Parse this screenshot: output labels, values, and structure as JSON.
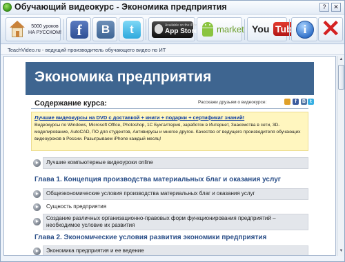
{
  "window": {
    "title": "Обучающий видеокурс - Экономика предприятия",
    "controls": [
      "?",
      "✕"
    ]
  },
  "toolbar": {
    "home_text": "5000 уроков НА РУССКОМ!",
    "fb_glyph": "f",
    "vk_glyph": "B",
    "tw_glyph": "t",
    "appstore_small": "Available on the iPhone",
    "appstore_big": "App Store",
    "market": "market",
    "yt_you": "You",
    "yt_tube": "Tube",
    "info_glyph": "i",
    "close_glyph": "✕"
  },
  "status": "TeachVideo.ru - ведущий производитель обучающего видео по ИТ",
  "page": {
    "hero_title": "Экономика предприятия",
    "toc_title": "Содержание курса:",
    "share_text": "Расскажи друзьям о видеокурсе:",
    "promo_head": "Лучшие видеокурсы на DVD с доставкой + книги + подарки + сертификат знаний!",
    "promo_body": "Видеокурсы по Windows, Microsoft Office, Photoshop, 1С Бухгалтерия, заработок в Интернет, Знакомства в сети, 3D-моделирование, AutoCAD, ПО для студентов, Антивирусы и многое другое. Качество от ведущего производителя обучающих видеоуроков в России. Разыгрываем iPhone каждый месяц!",
    "intro_lesson": "Лучшие компьютерные видеоуроки online",
    "chapter1": {
      "title": "Глава 1. Концепция производства материальных благ и оказания услуг",
      "lessons": [
        "Общеэкономические условия производства материальных благ и оказания услуг",
        "Сущность предприятия",
        "Создание различных организационно-правовых форм функционирования предприятий – необходимое условие их развития"
      ]
    },
    "chapter2": {
      "title": "Глава 2. Экономические условия развития экономики предприятия",
      "lessons": [
        "Экономика предприятия и ее ведение"
      ]
    }
  },
  "scroll": {
    "up": "▲",
    "down": "▼"
  }
}
